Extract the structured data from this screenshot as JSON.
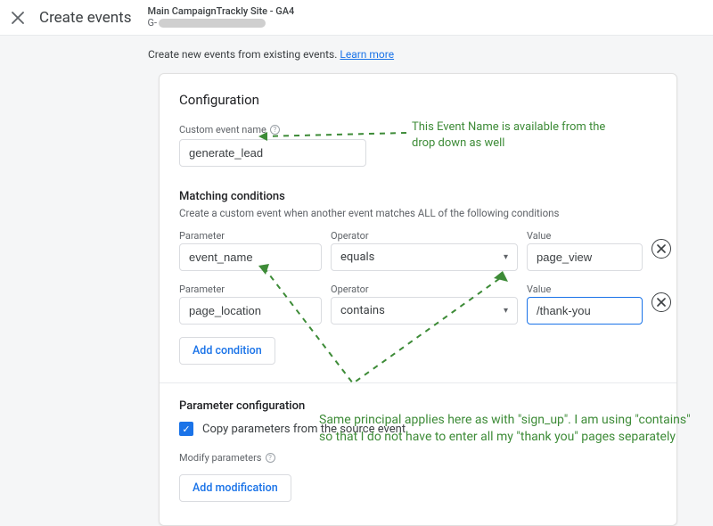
{
  "header": {
    "title": "Create events",
    "site_title": "Main CampaignTrackly Site - GA4",
    "site_id_prefix": "G-"
  },
  "intro": {
    "text": "Create new events from existing events.",
    "learn_more": "Learn more"
  },
  "panel": {
    "title": "Configuration",
    "custom_event_label": "Custom event name",
    "custom_event_value": "generate_lead",
    "matching": {
      "heading": "Matching conditions",
      "subtext": "Create a custom event when another event matches ALL of the following conditions",
      "labels": {
        "parameter": "Parameter",
        "operator": "Operator",
        "value": "Value"
      },
      "rows": [
        {
          "parameter": "event_name",
          "operator": "equals",
          "value": "page_view"
        },
        {
          "parameter": "page_location",
          "operator": "contains",
          "value": "/thank-you"
        }
      ],
      "add_condition": "Add condition"
    },
    "param_config": {
      "heading": "Parameter configuration",
      "copy_label": "Copy parameters from the source event",
      "copy_checked": true,
      "modify_label": "Modify parameters",
      "add_modification": "Add modification"
    }
  },
  "annotations": {
    "event_name_note": "This Event Name is available from the drop down as well",
    "contains_note": "Same principal applies here as with \"sign_up\". I am using \"contains\" so that I do not have to enter all my \"thank you\" pages separately"
  },
  "colors": {
    "accent": "#1a73e8",
    "annotation": "#3d8b37"
  }
}
